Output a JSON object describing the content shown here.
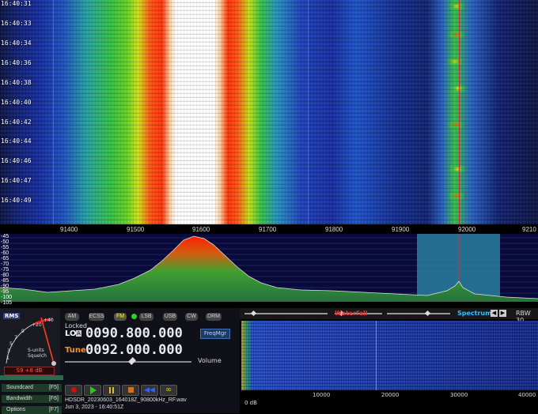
{
  "waterfall": {
    "timestamps": [
      "16:40:31",
      "16:40:33",
      "16:40:34",
      "16:40:36",
      "16:40:38",
      "16:40:40",
      "16:40:42",
      "16:40:44",
      "16:40:46",
      "16:40:47",
      "16:40:49"
    ],
    "freq_ticks": [
      "91400",
      "91500",
      "91600",
      "91700",
      "91800",
      "91900",
      "92000",
      "9210"
    ]
  },
  "spectrum": {
    "db_labels": [
      "-45",
      "-50",
      "-55",
      "-60",
      "-65",
      "-70",
      "-75",
      "-80",
      "-85",
      "-90",
      "-95",
      "-100",
      "-105"
    ]
  },
  "colors": {
    "accent": "#ff4020",
    "panel": "#101018",
    "spectrum_label": "#30c0ff",
    "waterfall_label": "#e03030"
  },
  "smeter": {
    "rms": "RMS",
    "plus40": "+40",
    "plus20": "+20",
    "s_units": "S-units",
    "squelch": "Squelch",
    "reading": "S9 +8 dB",
    "n9": "9",
    "n7": "7",
    "n5": "5",
    "n3": "3",
    "n1": "1"
  },
  "modes": [
    "AM",
    "ECSS",
    "FM",
    "LSB",
    "USB",
    "CW",
    "DRM"
  ],
  "lo": {
    "locked": "Locked",
    "lo_label": "LO",
    "lock_badge": "A",
    "value": "0090.800.000"
  },
  "tune": {
    "label": "Tune",
    "value": "0092.000.000"
  },
  "freqmgr": "FreqMgr",
  "volume": "Volume",
  "side_buttons": {
    "soundcard": "Soundcard",
    "soundcard_key": "[F5]",
    "bandwidth": "Bandwidth",
    "bandwidth_key": "[F6]",
    "options": "Options",
    "options_key": "[F7]"
  },
  "file": {
    "name": "HDSDR_20230603_164018Z_90800kHz_RF.wav",
    "date": "Jun 3, 2023 - 16:40:51Z"
  },
  "right": {
    "waterfall_label": "Waterfall",
    "spectrum_label": "Spectrum",
    "rbw": "RBW 30",
    "axis_ticks": [
      "0 dB",
      "10000",
      "20000",
      "30000",
      "40000"
    ]
  }
}
